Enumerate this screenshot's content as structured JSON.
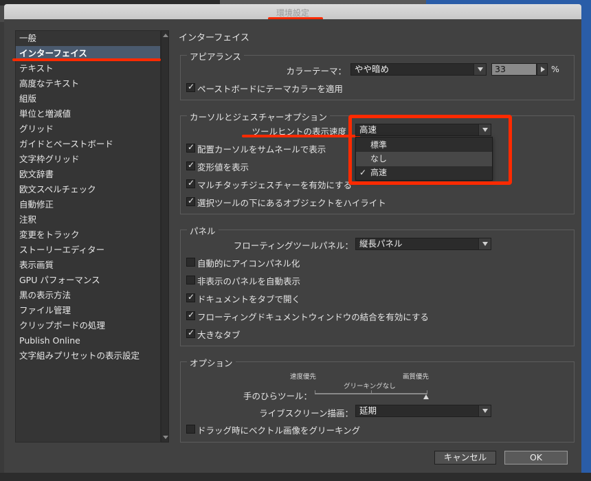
{
  "window": {
    "title": "環境設定"
  },
  "sidebar": {
    "items": [
      {
        "label": "一般"
      },
      {
        "label": "インターフェイス"
      },
      {
        "label": "テキスト"
      },
      {
        "label": "高度なテキスト"
      },
      {
        "label": "組版"
      },
      {
        "label": "単位と増減値"
      },
      {
        "label": "グリッド"
      },
      {
        "label": "ガイドとペーストボード"
      },
      {
        "label": "文字枠グリッド"
      },
      {
        "label": "欧文辞書"
      },
      {
        "label": "欧文スペルチェック"
      },
      {
        "label": "自動修正"
      },
      {
        "label": "注釈"
      },
      {
        "label": "変更をトラック"
      },
      {
        "label": "ストーリーエディター"
      },
      {
        "label": "表示画質"
      },
      {
        "label": "GPU パフォーマンス"
      },
      {
        "label": "黒の表示方法"
      },
      {
        "label": "ファイル管理"
      },
      {
        "label": "クリップボードの処理"
      },
      {
        "label": "Publish Online"
      },
      {
        "label": "文字組みプリセットの表示設定"
      }
    ],
    "selected": "インターフェイス"
  },
  "main": {
    "section_title": "インターフェイス",
    "appearance": {
      "label": "アピアランス",
      "color_theme_label": "カラーテーマ：",
      "color_theme_value": "やや暗め",
      "brightness_value": "33",
      "percent": "%",
      "pasteboard_label": "ペーストボードにテーマカラーを適用",
      "pasteboard_checked": true
    },
    "cursor": {
      "label": "カーソルとジェスチャーオプション",
      "tooltip_label": "ツールヒントの表示速度",
      "tooltip_value": "高速",
      "options": [
        "標準",
        "なし",
        "高速"
      ],
      "checked_option": "高速",
      "thumbnail_label": "配置カーソルをサムネールで表示",
      "thumbnail_checked": true,
      "transform_label": "変形値を表示",
      "transform_checked": true,
      "multitouch_label": "マルチタッチジェスチャーを有効にする",
      "multitouch_checked": true,
      "highlight_label": "選択ツールの下にあるオブジェクトをハイライト",
      "highlight_checked": true
    },
    "panel": {
      "label": "パネル",
      "floating_label": "フローティングツールパネル：",
      "floating_value": "縦長パネル",
      "auto_collapse_label": "自動的にアイコンパネル化",
      "auto_collapse_checked": false,
      "auto_show_label": "非表示のパネルを自動表示",
      "auto_show_checked": false,
      "tabs_label": "ドキュメントをタブで開く",
      "tabs_checked": true,
      "docking_label": "フローティングドキュメントウィンドウの結合を有効にする",
      "docking_checked": true,
      "large_tabs_label": "大きなタブ",
      "large_tabs_checked": true
    },
    "options": {
      "label": "オプション",
      "speed_priority": "速度優先",
      "quality_priority": "画質優先",
      "no_greeking": "グリーキングなし",
      "hand_tool_label": "手のひらツール：",
      "hand_tool_level": 1.0,
      "live_draw_label": "ライブスクリーン描画：",
      "live_draw_value": "延期",
      "greek_label": "ドラッグ時にベクトル画像をグリーキング",
      "greek_checked": false
    }
  },
  "buttons": {
    "cancel": "キャンセル",
    "ok": "OK"
  },
  "colors": {
    "annotation": "#ff2a00",
    "selection": "#4a5a6e",
    "background": "#414141"
  }
}
